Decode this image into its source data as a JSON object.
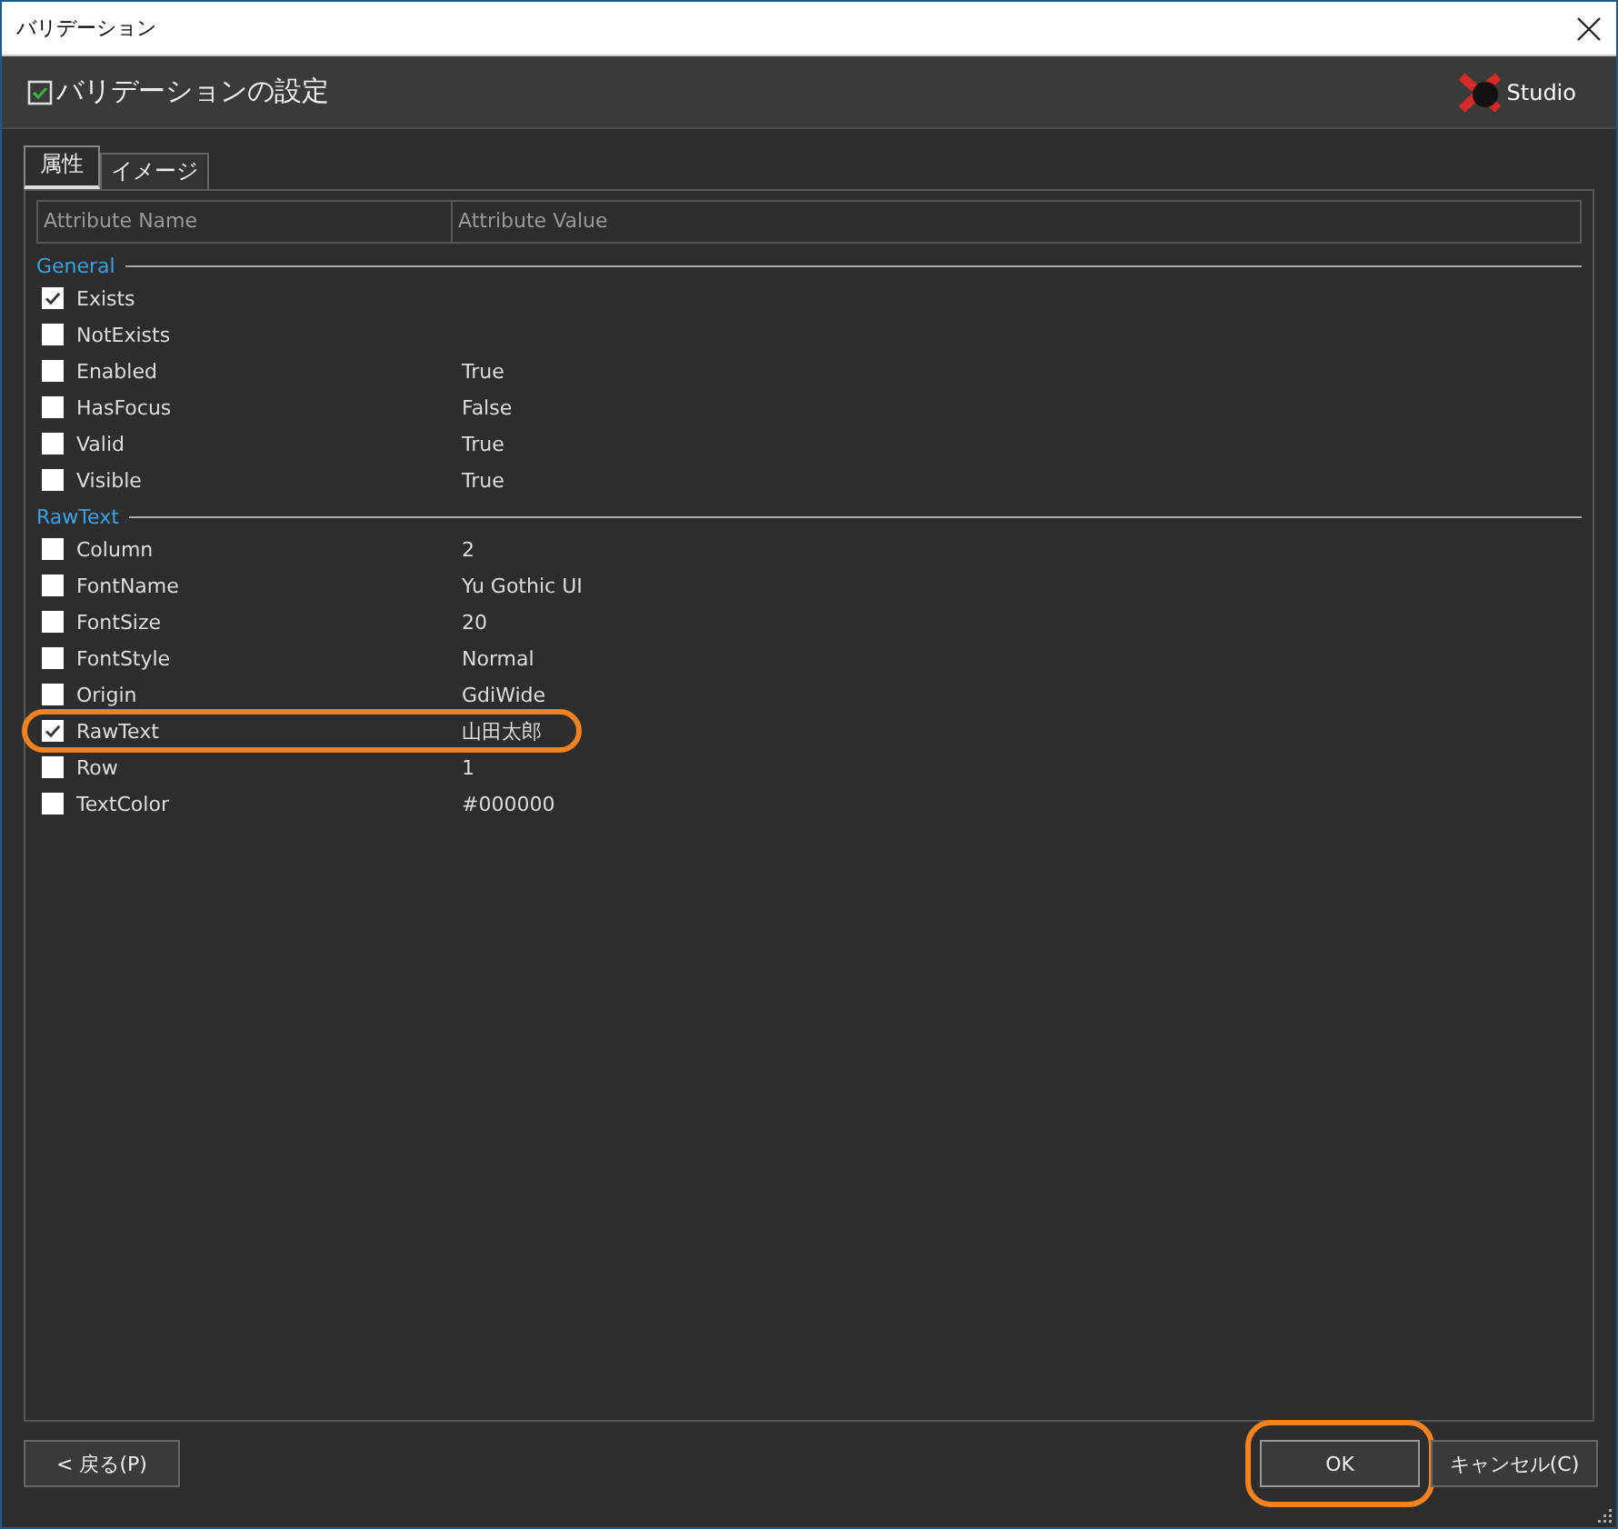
{
  "window": {
    "title": "バリデーション"
  },
  "header": {
    "title": "バリデーションの設定",
    "logo_text": "Studio"
  },
  "tabs": [
    {
      "label": "属性",
      "selected": true
    },
    {
      "label": "イメージ",
      "selected": false
    }
  ],
  "table": {
    "columns": [
      "Attribute Name",
      "Attribute Value"
    ],
    "groups": [
      {
        "title": "General",
        "rows": [
          {
            "name": "Exists",
            "value": "",
            "checked": true,
            "highlighted": false
          },
          {
            "name": "NotExists",
            "value": "",
            "checked": false,
            "highlighted": false
          },
          {
            "name": "Enabled",
            "value": "True",
            "checked": false,
            "highlighted": false
          },
          {
            "name": "HasFocus",
            "value": "False",
            "checked": false,
            "highlighted": false
          },
          {
            "name": "Valid",
            "value": "True",
            "checked": false,
            "highlighted": false
          },
          {
            "name": "Visible",
            "value": "True",
            "checked": false,
            "highlighted": false
          }
        ]
      },
      {
        "title": "RawText",
        "rows": [
          {
            "name": "Column",
            "value": "2",
            "checked": false,
            "highlighted": false
          },
          {
            "name": "FontName",
            "value": "Yu Gothic UI",
            "checked": false,
            "highlighted": false
          },
          {
            "name": "FontSize",
            "value": "20",
            "checked": false,
            "highlighted": false
          },
          {
            "name": "FontStyle",
            "value": "Normal",
            "checked": false,
            "highlighted": false
          },
          {
            "name": "Origin",
            "value": "GdiWide",
            "checked": false,
            "highlighted": false
          },
          {
            "name": "RawText",
            "value": "山田太郎",
            "checked": true,
            "highlighted": true
          },
          {
            "name": "Row",
            "value": "1",
            "checked": false,
            "highlighted": false
          },
          {
            "name": "TextColor",
            "value": "#000000",
            "checked": false,
            "highlighted": false
          }
        ]
      }
    ]
  },
  "buttons": {
    "back": {
      "label": "< 戻る(P)",
      "highlighted": false
    },
    "ok": {
      "label": "OK",
      "highlighted": true
    },
    "cancel": {
      "label": "キャンセル(C)",
      "highlighted": false
    }
  }
}
